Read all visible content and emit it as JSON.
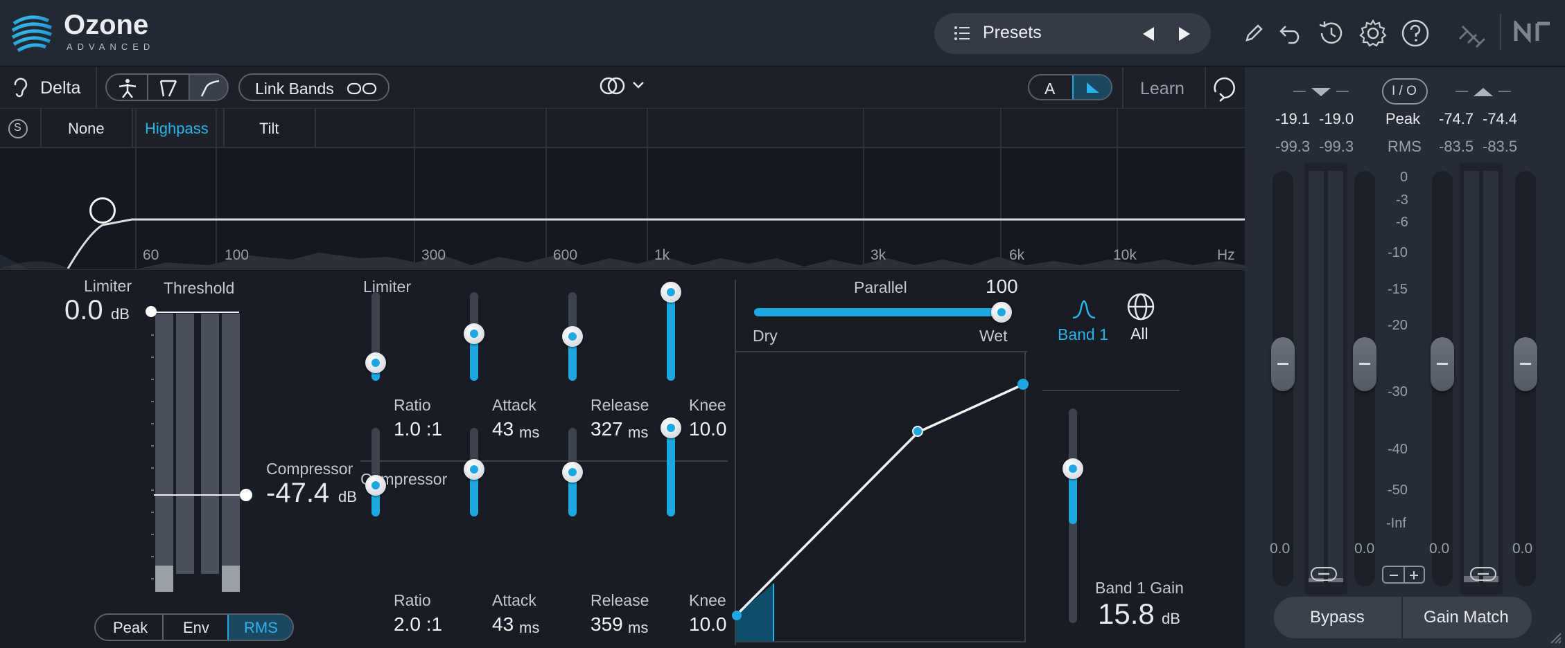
{
  "header": {
    "logo_title": "Ozone",
    "logo_subtitle": "ADVANCED",
    "presets_label": "Presets"
  },
  "toolbar": {
    "delta_label": "Delta",
    "link_bands_label": "Link Bands",
    "a_label": "A",
    "learn_label": "Learn"
  },
  "eq_tabs": {
    "solo_label": "S",
    "items": [
      "None",
      "Highpass",
      "Tilt"
    ],
    "active": "Highpass"
  },
  "spectrum": {
    "freq_labels": [
      "60",
      "100",
      "300",
      "600",
      "1k",
      "3k",
      "6k",
      "10k",
      "Hz"
    ]
  },
  "threshold": {
    "limiter_label": "Limiter",
    "limiter_value": "0.0",
    "limiter_unit": "dB",
    "threshold_label": "Threshold",
    "compressor_label": "Compressor",
    "compressor_value": "-47.4",
    "compressor_unit": "dB",
    "modes": [
      "Peak",
      "Env",
      "RMS"
    ],
    "active_mode": "RMS"
  },
  "limiter": {
    "section_label": "Limiter",
    "ratio_label": "Ratio",
    "ratio_value": "1.0 :1",
    "attack_label": "Attack",
    "attack_value": "43",
    "attack_unit": "ms",
    "release_label": "Release",
    "release_value": "327",
    "release_unit": "ms",
    "knee_label": "Knee",
    "knee_value": "10.0",
    "levels": {
      "ratio": 0.2,
      "attack": 0.53,
      "release": 0.5,
      "knee": 1.0
    }
  },
  "compressor": {
    "section_label": "Compressor",
    "ratio_label": "Ratio",
    "ratio_value": "2.0 :1",
    "attack_label": "Attack",
    "attack_value": "43",
    "attack_unit": "ms",
    "release_label": "Release",
    "release_value": "359",
    "release_unit": "ms",
    "knee_label": "Knee",
    "knee_value": "10.0",
    "levels": {
      "ratio": 0.35,
      "attack": 0.53,
      "release": 0.5,
      "knee": 1.0
    }
  },
  "parallel": {
    "label": "Parallel",
    "value": "100",
    "dry_label": "Dry",
    "wet_label": "Wet",
    "level": 1.0
  },
  "band": {
    "band1_label": "Band 1",
    "all_label": "All",
    "gain_label": "Band 1 Gain",
    "gain_value": "15.8",
    "gain_unit": "dB",
    "gain_level": 0.72
  },
  "meters": {
    "io_label": "I / O",
    "in_peak_l": "-19.1",
    "in_peak_r": "-19.0",
    "peak_label": "Peak",
    "out_peak_l": "-74.7",
    "out_peak_r": "-74.4",
    "in_rms_l": "-99.3",
    "in_rms_r": "-99.3",
    "rms_label": "RMS",
    "out_rms_l": "-83.5",
    "out_rms_r": "-83.5",
    "scale": [
      "0",
      "-3",
      "-6",
      "-10",
      "-15",
      "-20",
      "-30",
      "-40",
      "-50",
      "-Inf"
    ],
    "fader_values": [
      "0.0",
      "0.0",
      "0.0",
      "0.0"
    ],
    "bypass_label": "Bypass",
    "gain_match_label": "Gain Match"
  },
  "colors": {
    "accent": "#1ea7e0",
    "background": "#181c23",
    "panel": "#232932"
  }
}
